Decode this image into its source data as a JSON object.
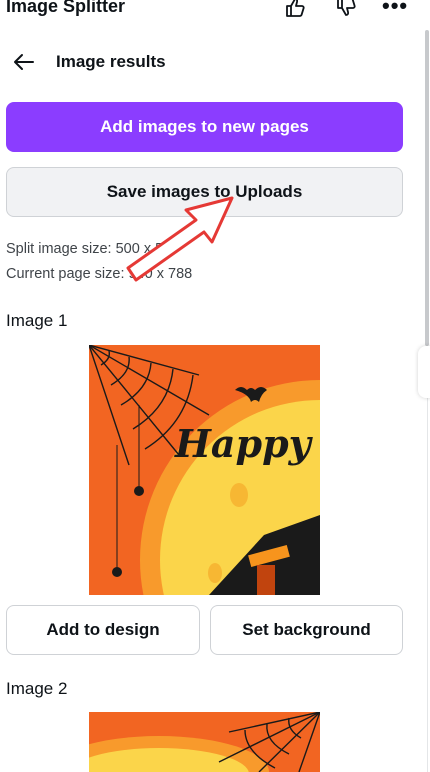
{
  "app": {
    "title": "Image Splitter"
  },
  "header": {
    "title": "Image results"
  },
  "actions": {
    "add_pages_label": "Add images to new pages",
    "save_uploads_label": "Save images to Uploads"
  },
  "info": {
    "split_size": "Split image size: 500 x 540",
    "page_size": "Current page size: 940 x 788"
  },
  "images": [
    {
      "label": "Image 1",
      "caption_text": "Happy",
      "add_label": "Add to design",
      "background_label": "Set background"
    },
    {
      "label": "Image 2"
    }
  ],
  "icons": {
    "title_bar": [
      "thumbs-up-icon",
      "thumbs-down-icon",
      "more-icon"
    ],
    "header": "back-arrow-icon"
  },
  "colors": {
    "accent": "#8b3dff",
    "annotation": "#e53935",
    "thumb_orange": "#f26522",
    "thumb_yellow": "#fbd54a"
  }
}
